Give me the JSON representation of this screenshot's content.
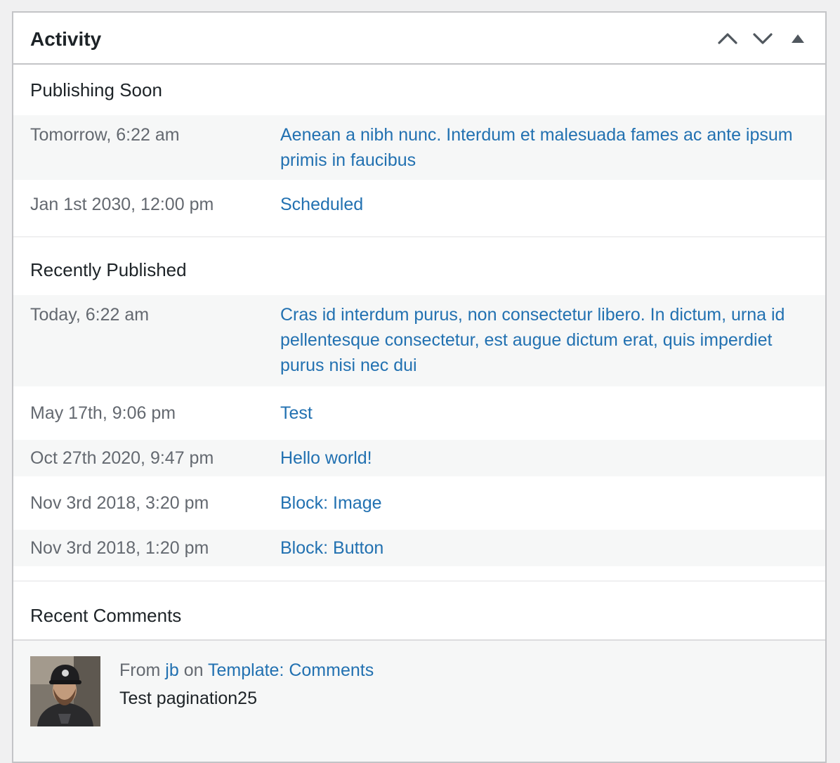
{
  "widget": {
    "title": "Activity",
    "controls": [
      "move-up-icon",
      "move-down-icon",
      "toggle-panel-icon"
    ]
  },
  "publishing_soon": {
    "heading": "Publishing Soon",
    "rows": [
      {
        "date": "Tomorrow, 6:22 am",
        "title": "Aenean a nibh nunc. Interdum et malesuada fames ac ante ipsum primis in faucibus"
      },
      {
        "date": "Jan 1st 2030, 12:00 pm",
        "title": "Scheduled"
      }
    ]
  },
  "recently_published": {
    "heading": "Recently Published",
    "rows": [
      {
        "date": "Today, 6:22 am",
        "title": "Cras id interdum purus, non consectetur libero. In dictum, urna id pellentesque consectetur, est augue dictum erat, quis imperdiet purus nisi nec dui"
      },
      {
        "date": "May 17th, 9:06 pm",
        "title": "Test"
      },
      {
        "date": "Oct 27th 2020, 9:47 pm",
        "title": "Hello world!"
      },
      {
        "date": "Nov 3rd 2018, 3:20 pm",
        "title": "Block: Image"
      },
      {
        "date": "Nov 3rd 2018, 1:20 pm",
        "title": "Block: Button"
      }
    ]
  },
  "recent_comments": {
    "heading": "Recent Comments",
    "comment": {
      "from_label": "From",
      "author": "jb",
      "on_label": "on",
      "post": "Template: Comments",
      "text": "Test pagination25"
    }
  },
  "colors": {
    "link": "#2271b1",
    "muted_text": "#646970",
    "text": "#1d2327",
    "border": "#c3c4c7",
    "alt_row": "#f6f7f7"
  }
}
